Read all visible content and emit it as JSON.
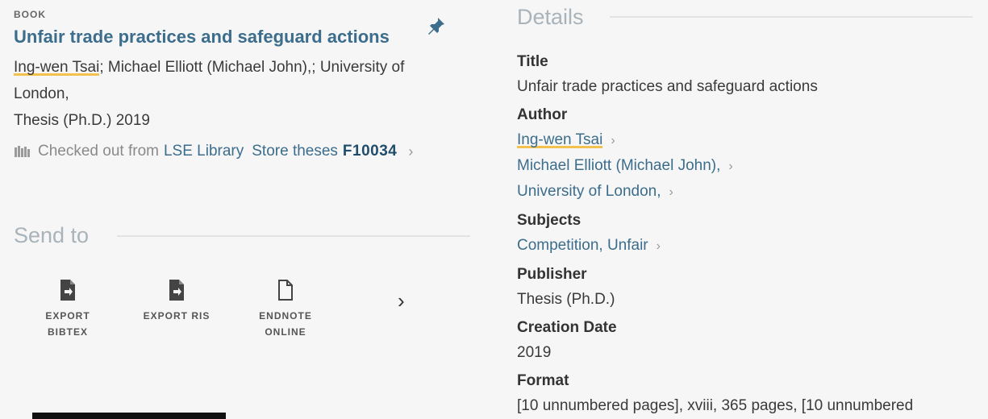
{
  "record": {
    "type": "BOOK",
    "title": "Unfair trade practices and safeguard actions",
    "author_primary": "Ing-wen Tsai",
    "authors_rest_line1": "; Michael Elliott (Michael John),; University of",
    "authors_line2": "London,",
    "publication_line": "Thesis (Ph.D.) 2019",
    "availability": {
      "status": "Checked out from",
      "library": "LSE Library",
      "location": "Store theses",
      "call_number": "F10034"
    }
  },
  "send_to": {
    "heading": "Send to",
    "items": [
      {
        "line1": "EXPORT",
        "line2": "BIBTEX",
        "icon": "export-file-icon"
      },
      {
        "line1": "EXPORT RIS",
        "line2": "",
        "icon": "export-file-icon"
      },
      {
        "line1": "ENDNOTE",
        "line2": "ONLINE",
        "icon": "document-icon"
      }
    ],
    "next_icon": "chevron-right-icon"
  },
  "details": {
    "heading": "Details",
    "title_label": "Title",
    "title_value": "Unfair trade practices and safeguard actions",
    "author_label": "Author",
    "authors": [
      "Ing-wen Tsai",
      "Michael Elliott (Michael John),",
      "University of London,"
    ],
    "subjects_label": "Subjects",
    "subjects": [
      "Competition, Unfair"
    ],
    "publisher_label": "Publisher",
    "publisher_value": "Thesis (Ph.D.)",
    "creation_date_label": "Creation Date",
    "creation_date_value": "2019",
    "format_label": "Format",
    "format_value": "[10 unnumbered pages], xviii, 365 pages, [10 unnumbered"
  },
  "colors": {
    "link": "#3c6d8c",
    "highlight": "#f2c14e",
    "section_heading": "#a9b3ba",
    "background": "#f6f6f6"
  }
}
